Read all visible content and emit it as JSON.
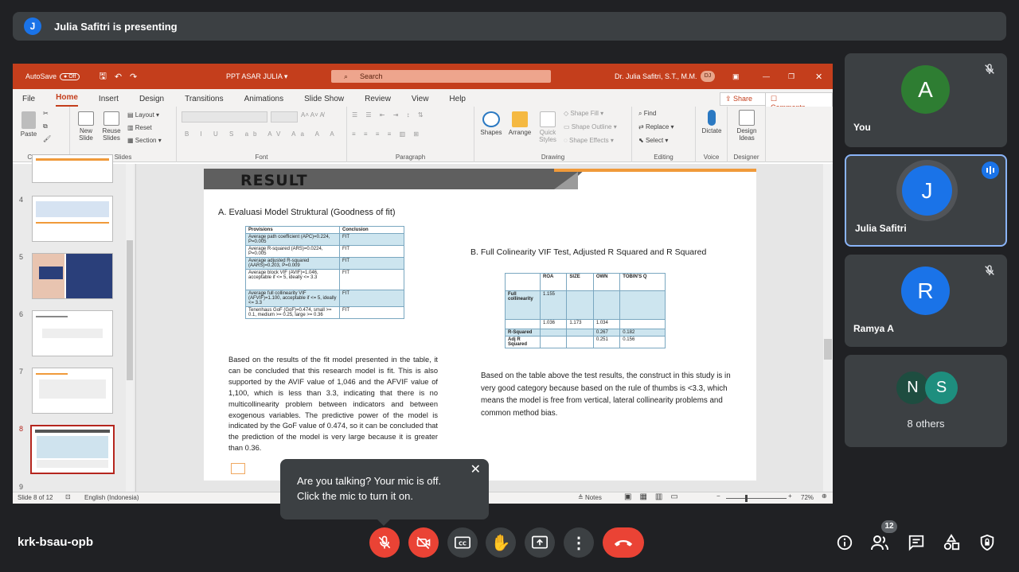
{
  "presenter": {
    "avatar": "J",
    "text": "Julia Safitri is presenting"
  },
  "ppt": {
    "autosave": "AutoSave",
    "autosave_state": "Off",
    "filename": "PPT ASAR JULIA",
    "search": "Search",
    "user": "Dr. Julia Safitri, S.T., M.M.",
    "user_initials": "DJ",
    "tabs": [
      "File",
      "Home",
      "Insert",
      "Design",
      "Transitions",
      "Animations",
      "Slide Show",
      "Review",
      "View",
      "Help"
    ],
    "share": "Share",
    "comments": "Comments",
    "ribbon": {
      "paste": "Paste",
      "clipboard": "Clipboard",
      "new_slide": "New Slide",
      "reuse_slides": "Reuse Slides",
      "layout": "Layout",
      "reset": "Reset",
      "section": "Section",
      "slides": "Slides",
      "font": "Font",
      "paragraph": "Paragraph",
      "shapes": "Shapes",
      "arrange": "Arrange",
      "quick_styles": "Quick Styles",
      "shape_fill": "Shape Fill",
      "shape_outline": "Shape Outline",
      "shape_effects": "Shape Effects",
      "drawing": "Drawing",
      "find": "Find",
      "replace": "Replace",
      "select": "Select",
      "editing": "Editing",
      "dictate": "Dictate",
      "voice": "Voice",
      "design_ideas": "Design Ideas",
      "designer": "Designer"
    },
    "thumb_numbers": [
      "4",
      "5",
      "6",
      "7",
      "8",
      "9"
    ],
    "status": {
      "slide": "Slide 8 of 12",
      "lang": "English (Indonesia)",
      "notes": "Notes",
      "zoom": "72%"
    }
  },
  "slide": {
    "header": "RESULT",
    "a_title": "A.   Evaluasi Model Struktural (Goodness of fit)",
    "t1_head": [
      "Provisions",
      "Conclusion"
    ],
    "t1_rows": [
      [
        "Average path coefficient (APC)=0.224, P=0.005",
        "FIT"
      ],
      [
        "Average R-squared (ARS)=0.0224, P=0.005",
        "FIT"
      ],
      [
        "Average adjusted R-squared (AARS)=0.203, P=0.009",
        "FIT"
      ],
      [
        "Average block VIF (AVIF)=1.046, acceptable if <= 5, ideally <= 3.3",
        "FIT"
      ],
      [
        "Average full collinearity VIF (AFVIF)=1.100, acceptable if <= 5, ideally <= 3.3",
        "FIT"
      ],
      [
        "Tenenhaus GoF (GoF)=0.474, small >= 0.1, medium >= 0.25, large >= 0.36",
        "FIT"
      ]
    ],
    "para_a": "Based on the results of the fit model presented in the table, it can be concluded that this research model is fit. This is also supported by the AVIF value of 1,046 and the AFVIF value of 1,100, which is less than 3.3, indicating that there is no multicollinearity problem between indicators and between exogenous variables. The predictive power of the model is indicated by the GoF value of 0.474, so it can be concluded that the prediction of the model is very large because it is greater than 0.36.",
    "b_title": "B.    Full Colinearity VIF Test, Adjusted R Squared and R Squared",
    "t2_head": [
      "",
      "ROA",
      "SIZE",
      "OWN",
      "TOBIN'S Q"
    ],
    "t2_rows": [
      [
        "Full collinearity",
        "1.155",
        "",
        "",
        ""
      ],
      [
        "",
        "1.036",
        "1.173",
        "1.034",
        ""
      ],
      [
        "R-Squared",
        "",
        "",
        "0.267",
        "0.182"
      ],
      [
        "Adj R Squared",
        "",
        "",
        "0.251",
        "0.156"
      ]
    ],
    "para_b": "Based on the table above the test results, the construct in this study is in very good category because based on the rule of thumbs is <3.3, which means the model is free from vertical, lateral collinearity problems and common method bias."
  },
  "participants": [
    {
      "initial": "A",
      "name": "You",
      "color": "#2e7d32",
      "muted": true
    },
    {
      "initial": "J",
      "name": "Julia Safitri",
      "color": "#1a73e8",
      "speaking": true
    },
    {
      "initial": "R",
      "name": "Ramya A",
      "color": "#1a73e8",
      "muted": true
    }
  ],
  "others": {
    "initials": [
      "N",
      "S"
    ],
    "colors": [
      "#1e4d40",
      "#1e8e7e"
    ],
    "label": "8 others"
  },
  "tooltip": {
    "line1": "Are you talking? Your mic is off.",
    "line2": "Click the mic to turn it on."
  },
  "meeting_code": "krk-bsau-opb",
  "people_count": "12",
  "colors": {
    "end_call": "#ea4335",
    "dark": "#3c4043"
  }
}
